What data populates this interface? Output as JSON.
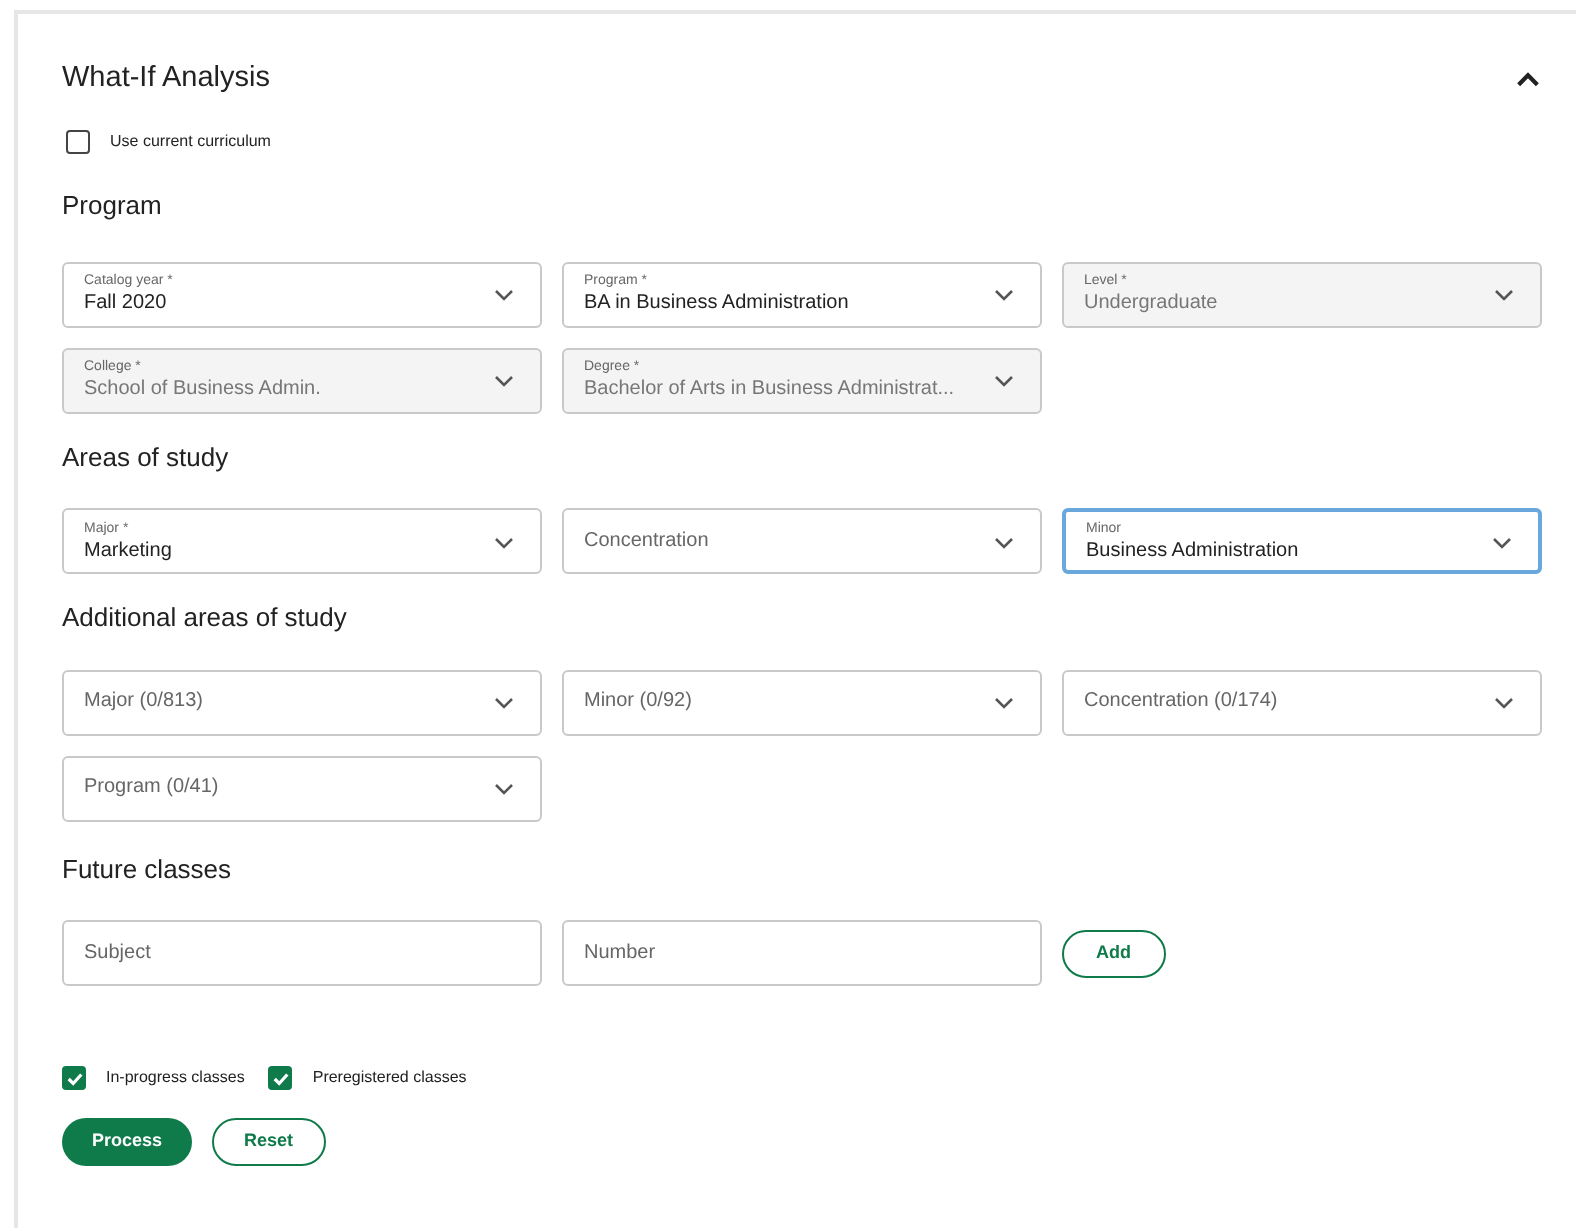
{
  "panel": {
    "title": "What-If Analysis",
    "expanded": true
  },
  "use_current": {
    "label": "Use current curriculum",
    "checked": false
  },
  "sections": [
    {
      "heading": "Program",
      "fields": [
        {
          "label": "Catalog year *",
          "value": "Fall 2020",
          "disabled": false,
          "focused": false
        },
        {
          "label": "Program *",
          "value": "BA in Business Administration",
          "disabled": false,
          "focused": false
        },
        {
          "label": "Level *",
          "value": "Undergraduate",
          "disabled": true,
          "focused": false
        },
        {
          "label": "College *",
          "value": "School of Business Admin.",
          "disabled": true,
          "focused": false
        },
        {
          "label": "Degree *",
          "value": "Bachelor of Arts in Business Administrat...",
          "disabled": true,
          "focused": false
        }
      ]
    },
    {
      "heading": "Areas of study",
      "fields": [
        {
          "label": "Major *",
          "value": "Marketing",
          "disabled": false,
          "focused": false
        },
        {
          "placeholder": "Concentration",
          "disabled": false,
          "focused": false
        },
        {
          "label": "Minor",
          "value": "Business Administration",
          "disabled": false,
          "focused": true
        }
      ]
    },
    {
      "heading": "Additional areas of study",
      "fields": [
        {
          "placeholder": "Major (0/813)",
          "disabled": false,
          "focused": false
        },
        {
          "placeholder": "Minor (0/92)",
          "disabled": false,
          "focused": false
        },
        {
          "placeholder": "Concentration (0/174)",
          "disabled": false,
          "focused": false
        },
        {
          "placeholder": "Program (0/41)",
          "disabled": false,
          "focused": false
        }
      ]
    }
  ],
  "future_classes": {
    "heading": "Future classes",
    "inputs": [
      {
        "placeholder": "Subject"
      },
      {
        "placeholder": "Number"
      }
    ],
    "add_button": "Add"
  },
  "options": [
    {
      "label": "In-progress classes",
      "checked": true
    },
    {
      "label": "Preregistered classes",
      "checked": true
    }
  ],
  "buttons": [
    {
      "label": "Process",
      "kind": "primary"
    },
    {
      "label": "Reset",
      "kind": "secondary"
    }
  ]
}
